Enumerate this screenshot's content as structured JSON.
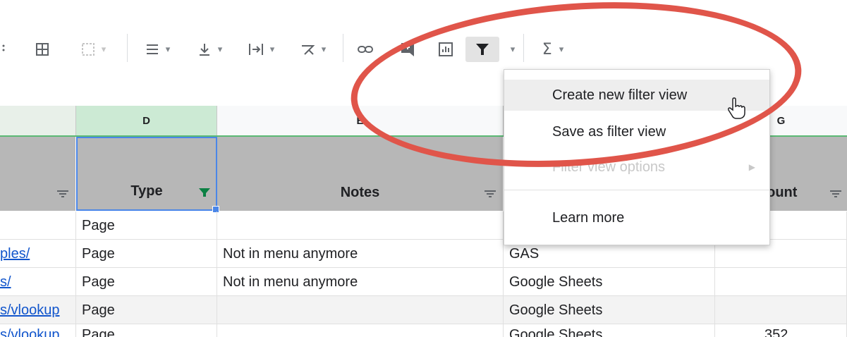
{
  "toolbar": {
    "icons": [
      "borders-icon",
      "merge-icon",
      "align-horizontal-icon",
      "align-vertical-icon",
      "text-wrap-icon",
      "text-rotate-icon",
      "link-icon",
      "comment-icon",
      "chart-icon",
      "filter-icon",
      "functions-icon"
    ]
  },
  "columns": {
    "d": "D",
    "e": "E",
    "g": "G"
  },
  "header": {
    "type": "Type",
    "notes": "Notes",
    "count": "count"
  },
  "rows": [
    {
      "url": "",
      "type": "Page",
      "notes": "",
      "category": "",
      "count": ""
    },
    {
      "url": "ples/",
      "type": "Page",
      "notes": "Not in menu anymore",
      "category": "GAS",
      "count": ""
    },
    {
      "url": "s/",
      "type": "Page",
      "notes": "Not in menu anymore",
      "category": "Google Sheets",
      "count": ""
    },
    {
      "url": "s/vlookup",
      "type": "Page",
      "notes": "",
      "category": "Google Sheets",
      "count": ""
    },
    {
      "url": "s/vlookup",
      "type": "Page",
      "notes": "",
      "category": "Google Sheets",
      "count": "352"
    }
  ],
  "menu": {
    "create": "Create new filter view",
    "save": "Save as filter view",
    "options": "Filter view options",
    "learn": "Learn more"
  },
  "colors": {
    "accent_green": "#5bb974",
    "annotation_red": "#e0554a",
    "link": "#1155cc"
  }
}
